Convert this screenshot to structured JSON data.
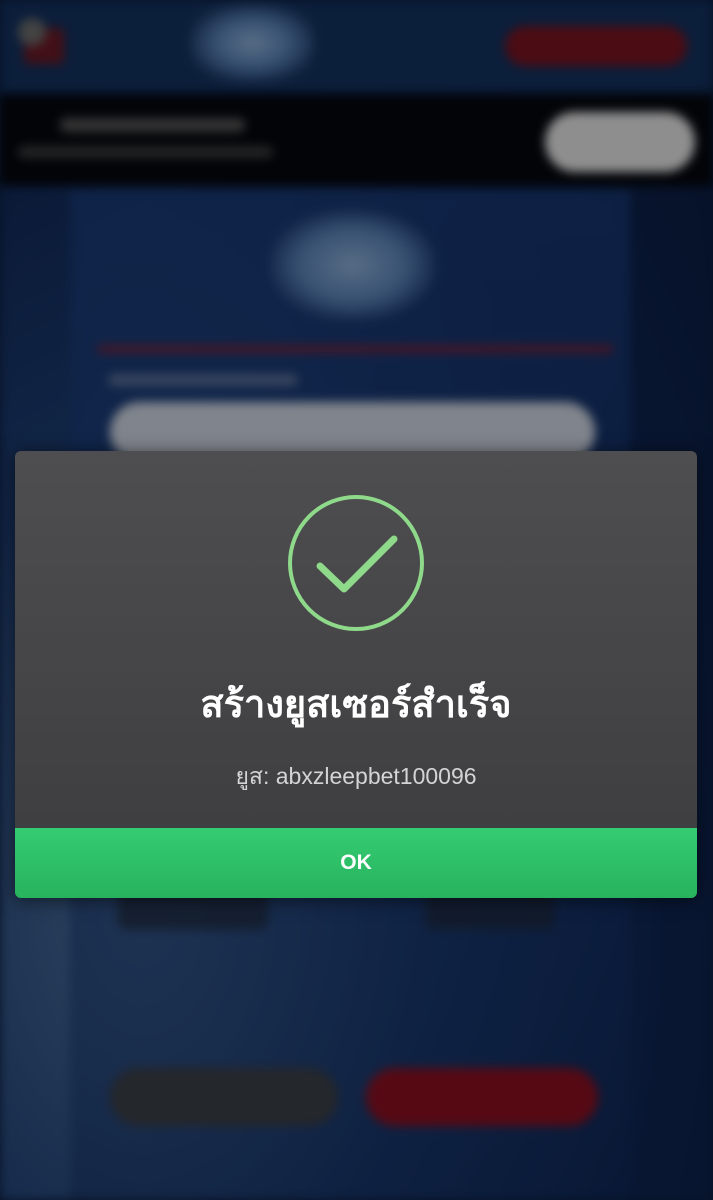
{
  "modal": {
    "icon": "check-circle-icon",
    "title": "สร้างยูสเซอร์สำเร็จ",
    "subtitle": "ยูส: abxzleepbet100096",
    "ok_label": "OK",
    "colors": {
      "accent_green": "#2ebf67",
      "check_stroke": "#8fd98a",
      "modal_bg": "#434345"
    }
  }
}
